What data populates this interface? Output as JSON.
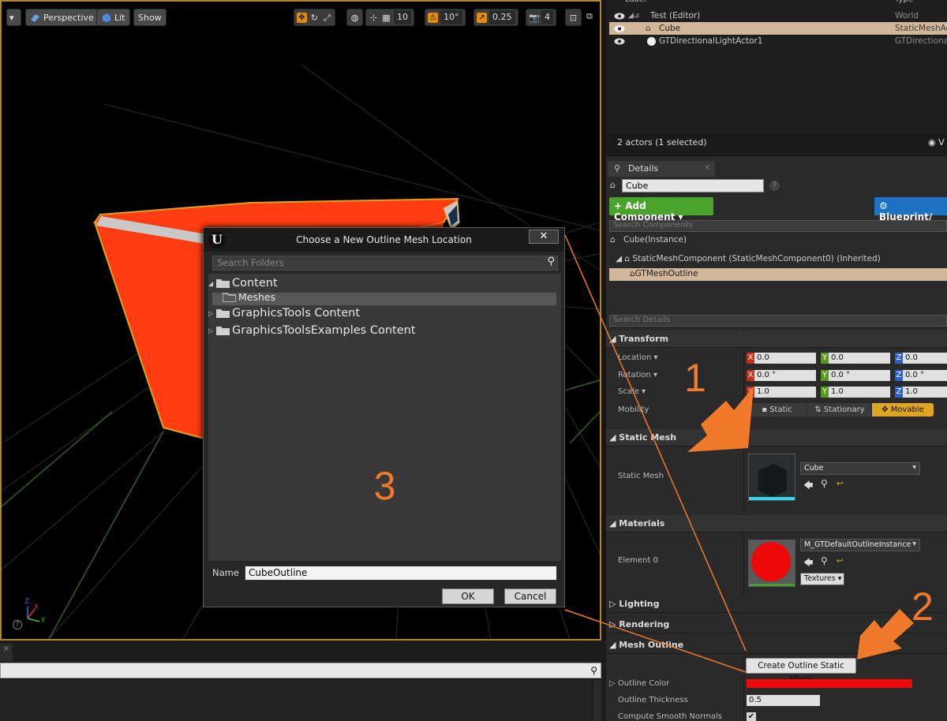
{
  "viewport": {
    "toolbar": {
      "perspective_label": "Perspective",
      "lit_label": "Lit",
      "show_label": "Show",
      "grid_snap_value": "10",
      "rotation_snap_value": "10°",
      "scale_snap_value": "0.25",
      "camera_speed_value": "4"
    },
    "axis": {
      "x": "X",
      "y": "Y",
      "z": "Z"
    },
    "colors": {
      "cube_face": "#ff3c12",
      "selection_outline": "#e0a020"
    }
  },
  "bottom_left": {
    "tab_close": "×"
  },
  "outliner": {
    "header": {
      "label_col": "Label",
      "type_col": "Type"
    },
    "rows": [
      {
        "label": "Test (Editor)",
        "type": "World"
      },
      {
        "label": "Cube",
        "type": "StaticMeshAc"
      },
      {
        "label": "GTDirectionalLightActor1",
        "type": "GTDirectional"
      }
    ],
    "footer_status": "2 actors (1 selected)",
    "view_options_label": "V"
  },
  "details": {
    "tab_label": "Details",
    "tab_close": "×",
    "actor_name": "Cube",
    "add_component_label": "+ Add Component ▾",
    "blueprint_label": "Blueprint/",
    "search_components_placeholder": "Search Components",
    "components": {
      "instance": "Cube(Instance)",
      "static_mesh_component": "StaticMeshComponent (StaticMeshComponent0) (Inherited)",
      "mesh_outline": "GTMeshOutline"
    },
    "search_details_placeholder": "Search Details",
    "transform": {
      "title": "Transform",
      "location_label": "Location ▾",
      "rotation_label": "Rotation ▾",
      "scale_label": "Scale ▾",
      "mobility_label": "Mobility",
      "location": [
        "0.0",
        "0.0",
        "0.0"
      ],
      "rotation": [
        "0.0 °",
        "0.0 °",
        "0.0 °"
      ],
      "scale": [
        "1.0",
        "1.0",
        "1.0"
      ],
      "axis_tags": [
        "X",
        "Y",
        "Z"
      ],
      "mobility_options": [
        "Static",
        "Stationary",
        "Movable"
      ],
      "mobility_selected": "Movable"
    },
    "static_mesh": {
      "title": "Static Mesh",
      "label": "Static Mesh",
      "value": "Cube"
    },
    "materials": {
      "title": "Materials",
      "element_label": "Element 0",
      "value": "M_GTDefaultOutlineInstance",
      "textures_label": "Textures ▾"
    },
    "lighting_title": "Lighting",
    "rendering_title": "Rendering",
    "mesh_outline": {
      "title": "Mesh Outline",
      "create_button": "Create Outline Static Mesh",
      "outline_color_label": "Outline Color",
      "outline_color_value": "#ee0a0a",
      "outline_thickness_label": "Outline Thickness",
      "outline_thickness_value": "0.5",
      "compute_normals_label": "Compute Smooth Normals",
      "compute_normals_checked": true
    }
  },
  "dialog": {
    "title": "Choose a New Outline Mesh Location",
    "close_label": "✕",
    "search_placeholder": "Search Folders",
    "tree": [
      {
        "label": "Content",
        "expanded": true
      },
      {
        "label": "Meshes",
        "selected": true
      },
      {
        "label": "GraphicsTools Content",
        "expanded": false
      },
      {
        "label": "GraphicsToolsExamples Content",
        "expanded": false
      }
    ],
    "name_label": "Name",
    "name_value": "CubeOutline",
    "ok_label": "OK",
    "cancel_label": "Cancel"
  },
  "annotations": {
    "step1": "1",
    "step2": "2",
    "step3": "3",
    "color": "#f07a2a"
  }
}
